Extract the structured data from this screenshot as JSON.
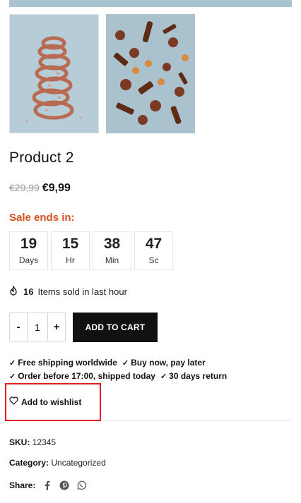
{
  "product": {
    "title": "Product 2",
    "old_price": "€29,99",
    "new_price": "€9,99"
  },
  "sale": {
    "label": "Sale ends in:",
    "countdown": [
      {
        "value": "19",
        "unit": "Days"
      },
      {
        "value": "15",
        "unit": "Hr"
      },
      {
        "value": "38",
        "unit": "Min"
      },
      {
        "value": "47",
        "unit": "Sc"
      }
    ]
  },
  "sold": {
    "count": "16",
    "text": "Items sold in last hour"
  },
  "cart": {
    "minus": "-",
    "quantity": "1",
    "plus": "+",
    "add_label": "ADD TO CART"
  },
  "perks": {
    "row1": [
      "Free shipping worldwide",
      "Buy now, pay later"
    ],
    "row2": [
      "Order before 17:00, shipped today",
      "30 days return"
    ]
  },
  "wishlist": {
    "label": "Add to wishlist"
  },
  "meta": {
    "sku_label": "SKU:",
    "sku_value": "12345",
    "category_label": "Category:",
    "category_value": "Uncategorized",
    "share_label": "Share:"
  },
  "icons": {
    "fire": "fire-icon",
    "heart": "heart-icon",
    "check": "check-icon",
    "facebook": "facebook-icon",
    "pinterest": "pinterest-icon",
    "whatsapp": "whatsapp-icon"
  },
  "colors": {
    "sale_accent": "#d4501e",
    "button_bg": "#111111",
    "highlight": "#e02020",
    "image_bg": "#a7c4cf"
  }
}
